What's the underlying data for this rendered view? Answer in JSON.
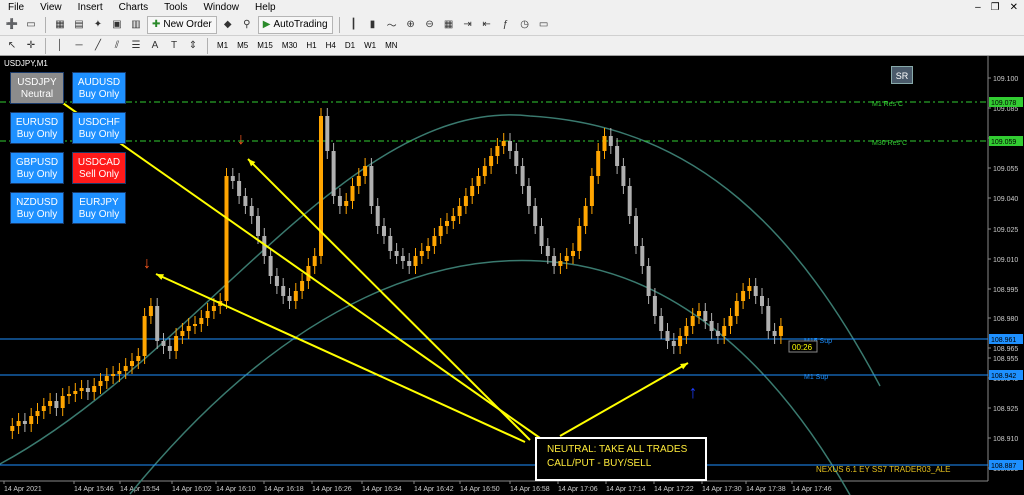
{
  "menu": {
    "items": [
      "File",
      "View",
      "Insert",
      "Charts",
      "Tools",
      "Window",
      "Help"
    ]
  },
  "toolbar": {
    "new_order": "New Order",
    "autotrading": "AutoTrading",
    "timeframes": [
      "M1",
      "M5",
      "M15",
      "M30",
      "H1",
      "H4",
      "D1",
      "W1",
      "MN"
    ]
  },
  "chart": {
    "title": "USDJPY,M1",
    "sr_button": "SR",
    "pairs": [
      {
        "symbol": "USDJPY",
        "status": "Neutral",
        "color": "#8c8c8c"
      },
      {
        "symbol": "AUDUSD",
        "status": "Buy Only",
        "color": "#1e90ff"
      },
      {
        "symbol": "EURUSD",
        "status": "Buy Only",
        "color": "#1e90ff"
      },
      {
        "symbol": "USDCHF",
        "status": "Buy Only",
        "color": "#1e90ff"
      },
      {
        "symbol": "GBPUSD",
        "status": "Buy Only",
        "color": "#1e90ff"
      },
      {
        "symbol": "USDCAD",
        "status": "Sell Only",
        "color": "#ff1a1a"
      },
      {
        "symbol": "NZDUSD",
        "status": "Buy Only",
        "color": "#1e90ff"
      },
      {
        "symbol": "EURJPY",
        "status": "Buy Only",
        "color": "#1e90ff"
      }
    ],
    "note_line1": "NEUTRAL: TAKE ALL TRADES",
    "note_line2": "CALL/PUT - BUY/SELL",
    "footer_label": "NEXUS 6.1 EY SS7 TRADER03_ALE",
    "timer": "00:26",
    "levels": {
      "m1_res": {
        "label": "M1 Res C",
        "price": "109.078",
        "color": "#32cd32"
      },
      "m5_res": {
        "label": "M30 Res C",
        "price": "109.059",
        "color": "#32cd32"
      },
      "m5_sup": {
        "label": "M15 Sup",
        "price": "108.961",
        "color": "#1e90ff"
      },
      "m1_sup": {
        "label": "M1 Sup",
        "price": "108.942",
        "color": "#1e90ff"
      },
      "bottom": {
        "price": "108.887",
        "color": "#1e90ff"
      }
    },
    "y_ticks": [
      "109.100",
      "109.085",
      "109.070",
      "109.055",
      "109.040",
      "109.025",
      "109.010",
      "108.995",
      "108.980",
      "108.965",
      "108.955",
      "108.940",
      "108.925",
      "108.910",
      "108.895"
    ],
    "x_ticks": [
      "14 Apr 2021",
      "14 Apr 15:46",
      "14 Apr 15:54",
      "14 Apr 16:02",
      "14 Apr 16:10",
      "14 Apr 16:18",
      "14 Apr 16:26",
      "14 Apr 16:34",
      "14 Apr 16:42",
      "14 Apr 16:50",
      "14 Apr 16:58",
      "14 Apr 17:06",
      "14 Apr 17:14",
      "14 Apr 17:22",
      "14 Apr 17:30",
      "14 Apr 17:38",
      "14 Apr 17:46"
    ],
    "colors": {
      "bull": "#ffa500",
      "bear": "#b0b0b0",
      "arrow": "#ffff00",
      "down_signal": "#ff5a1f",
      "up_signal": "#1e3cff",
      "curve": "#3a7a6f"
    }
  }
}
